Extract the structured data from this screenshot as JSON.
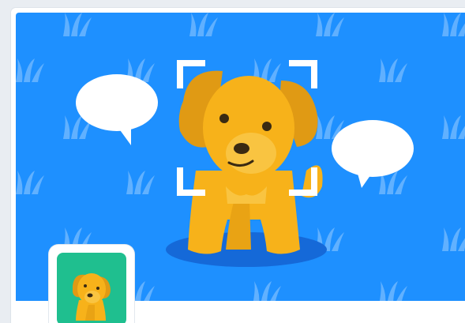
{
  "card": {
    "banner_icons": [
      "grass-pattern-icon",
      "speech-bubble-icon",
      "dog-character-icon",
      "selection-frame-icon"
    ],
    "thumbnail_icon": "dog-character-icon"
  },
  "colors": {
    "banner_background": "#1e90ff",
    "grass_pattern": "#6db7ff",
    "dog_body": "#f7b21a",
    "dog_ear": "#e09a14",
    "dog_shadow": "#1569d8",
    "speech_bubble": "#ffffff",
    "selection_frame": "#ffffff",
    "thumbnail_background": "#1fbf8f"
  }
}
